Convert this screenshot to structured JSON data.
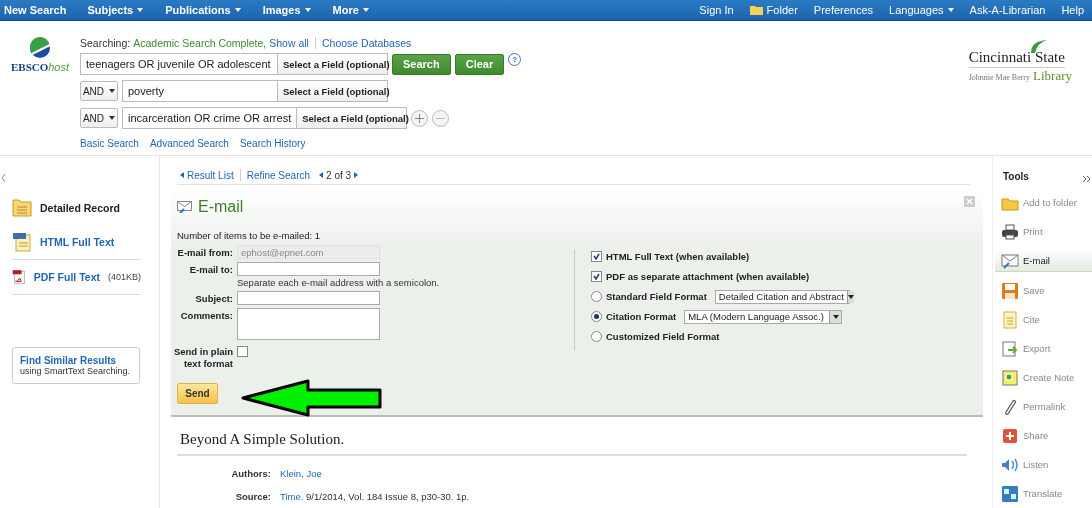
{
  "top_nav": {
    "left": [
      {
        "label": "New Search",
        "dropdown": false
      },
      {
        "label": "Subjects",
        "dropdown": true
      },
      {
        "label": "Publications",
        "dropdown": true
      },
      {
        "label": "Images",
        "dropdown": true
      },
      {
        "label": "More",
        "dropdown": true
      }
    ],
    "right": [
      {
        "label": "Sign In",
        "dropdown": false,
        "kind": "link"
      },
      {
        "label": "Folder",
        "dropdown": false,
        "kind": "folder"
      },
      {
        "label": "Preferences",
        "dropdown": false,
        "kind": "link"
      },
      {
        "label": "Languages",
        "dropdown": true,
        "kind": "link"
      },
      {
        "label": "Ask-A-Librarian",
        "dropdown": false,
        "kind": "link"
      },
      {
        "label": "Help",
        "dropdown": false,
        "kind": "link"
      }
    ]
  },
  "logo": {
    "text": "EBSCO",
    "suffix": "host"
  },
  "search": {
    "searching_label": "Searching:",
    "database": "Academic Search Complete,",
    "show_all": "Show all",
    "choose": "Choose Databases",
    "rows": [
      {
        "operator": null,
        "value": "teenagers OR juvenile OR adolescent",
        "field": "Select a Field (optional)"
      },
      {
        "operator": "AND",
        "value": "poverty",
        "field": "Select a Field (optional)"
      },
      {
        "operator": "AND",
        "value": "incarceration OR crime OR arrest",
        "field": "Select a Field (optional)"
      }
    ],
    "search_button": "Search",
    "clear_button": "Clear",
    "help": "?",
    "links": [
      "Basic Search",
      "Advanced Search",
      "Search History"
    ]
  },
  "library_logo": {
    "name": "Cincinnati State",
    "sub": "Johnnie Mae Berry",
    "library": "Library"
  },
  "sidebar": {
    "items": [
      {
        "label": "Detailed Record",
        "kind": "record"
      },
      {
        "label": "HTML Full Text",
        "kind": "html"
      },
      {
        "label": "PDF Full Text",
        "size": "(401KB)",
        "kind": "pdf"
      }
    ],
    "similar": {
      "title": "Find Similar Results",
      "text": "using SmartText Searching."
    }
  },
  "record_nav": {
    "result_list": "Result List",
    "refine": "Refine Search",
    "position": "2 of 3"
  },
  "email": {
    "title": "E-mail",
    "count": "Number of items to be e-mailed: 1",
    "fields": [
      {
        "label": "E-mail from:",
        "value": "ephost@epnet.com",
        "kind": "input",
        "disabled": true
      },
      {
        "label": "E-mail to:",
        "kind": "input",
        "disabled": false,
        "hint": "Separate each e-mail address with a semicolon."
      },
      {
        "label": "Subject:",
        "kind": "input",
        "disabled": false
      },
      {
        "label": "Comments:",
        "kind": "textarea",
        "disabled": false
      }
    ],
    "plain_text": {
      "label": "Send in plain text format",
      "checked": false
    },
    "options": [
      {
        "kind": "checkbox",
        "label": "HTML Full Text (when available)",
        "checked": true
      },
      {
        "kind": "checkbox",
        "label": "PDF as separate attachment (when available)",
        "checked": true
      },
      {
        "kind": "radio",
        "label": "Standard Field Format",
        "selected": false,
        "select": "Detailed Citation and Abstract"
      },
      {
        "kind": "radio",
        "label": "Citation Format",
        "selected": true,
        "select": "MLA (Modern Language Assoc.)"
      },
      {
        "kind": "radio",
        "label": "Customized Field Format",
        "selected": false
      }
    ],
    "send": "Send"
  },
  "record": {
    "title": "Beyond A Simple Solution.",
    "meta": [
      {
        "label": "Authors:",
        "link": "Klein, Joe"
      },
      {
        "label": "Source:",
        "link": "Time.",
        "text": "9/1/2014, Vol. 184 Issue 8, p30-30. 1p."
      }
    ]
  },
  "tools": {
    "title": "Tools",
    "items": [
      {
        "label": "Add to folder",
        "selected": false
      },
      {
        "label": "Print",
        "selected": false
      },
      {
        "label": "E-mail",
        "selected": true
      },
      {
        "label": "Save",
        "selected": false
      },
      {
        "label": "Cite",
        "selected": false
      },
      {
        "label": "Export",
        "selected": false
      },
      {
        "label": "Create Note",
        "selected": false
      },
      {
        "label": "Permalink",
        "selected": false
      },
      {
        "label": "Share",
        "selected": false
      },
      {
        "label": "Listen",
        "selected": false
      },
      {
        "label": "Translate",
        "selected": false
      }
    ]
  }
}
